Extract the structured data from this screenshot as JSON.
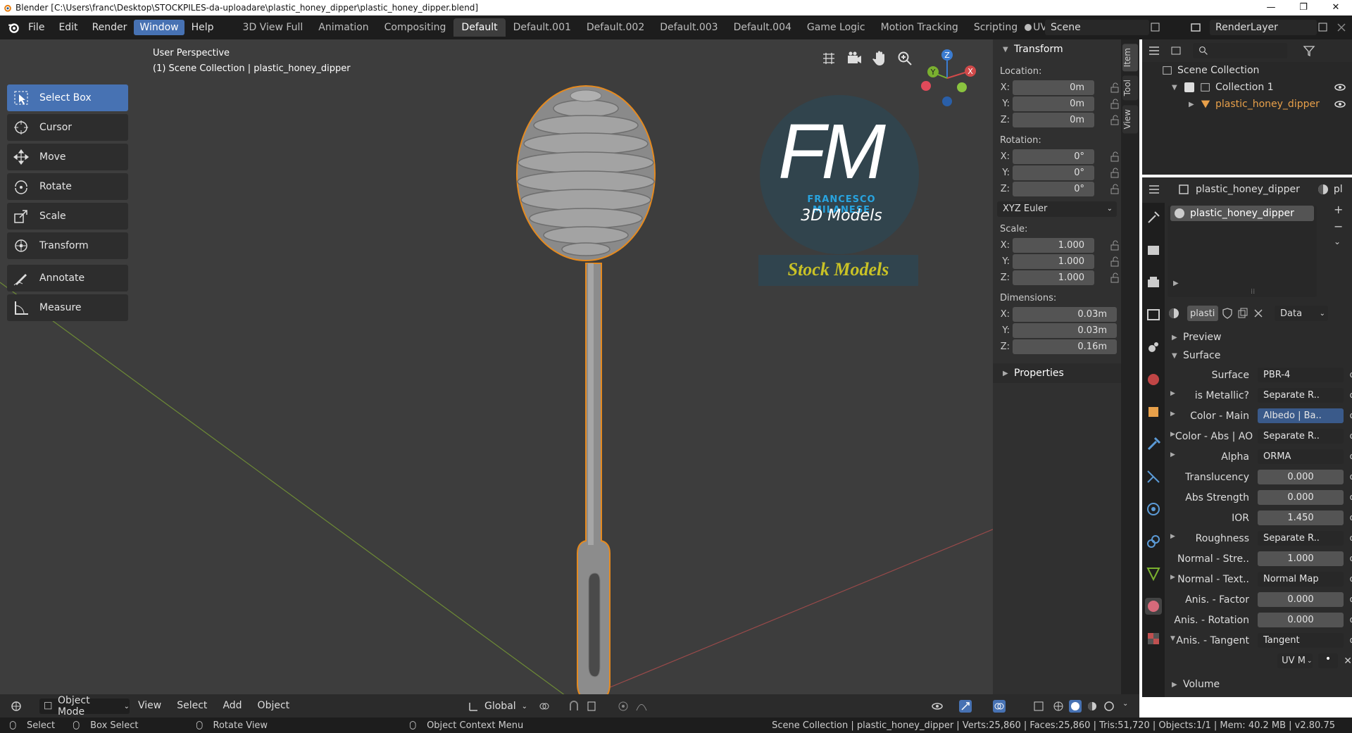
{
  "titlebar": {
    "title": "Blender [C:\\Users\\franc\\Desktop\\STOCKPILES-da-uploadare\\plastic_honey_dipper\\plastic_honey_dipper.blend]",
    "minimize": "—",
    "maximize": "❐",
    "close": "✕"
  },
  "menu": [
    "File",
    "Edit",
    "Render",
    "Window",
    "Help"
  ],
  "workspaces": [
    "3D View Full",
    "Animation",
    "Compositing",
    "Default",
    "Default.001",
    "Default.002",
    "Default.003",
    "Default.004",
    "Game Logic",
    "Motion Tracking",
    "Scripting",
    "UV Editing"
  ],
  "scene_name": "Scene",
  "renderlayer_name": "RenderLayer",
  "viewport": {
    "perspective": "User Perspective",
    "collection_info": "(1) Scene Collection | plastic_honey_dipper",
    "logo": {
      "letters": "FM",
      "name": "FRANCESCO MILANESE",
      "sub": "3D Models",
      "badge": "Stock Models"
    },
    "gizmo": {
      "x": "X",
      "y": "Y",
      "z": "Z"
    }
  },
  "tools": [
    "Select Box",
    "Cursor",
    "Move",
    "Rotate",
    "Scale",
    "Transform",
    "Annotate",
    "Measure"
  ],
  "npanel": {
    "transform_title": "Transform",
    "location_label": "Location:",
    "location": [
      {
        "axis": "X:",
        "value": "0m"
      },
      {
        "axis": "Y:",
        "value": "0m"
      },
      {
        "axis": "Z:",
        "value": "0m"
      }
    ],
    "rotation_label": "Rotation:",
    "rotation": [
      {
        "axis": "X:",
        "value": "0°"
      },
      {
        "axis": "Y:",
        "value": "0°"
      },
      {
        "axis": "Z:",
        "value": "0°"
      }
    ],
    "rotation_mode": "XYZ Euler",
    "scale_label": "Scale:",
    "scale": [
      {
        "axis": "X:",
        "value": "1.000"
      },
      {
        "axis": "Y:",
        "value": "1.000"
      },
      {
        "axis": "Z:",
        "value": "1.000"
      }
    ],
    "dimensions_label": "Dimensions:",
    "dimensions": [
      {
        "axis": "X:",
        "value": "0.03m"
      },
      {
        "axis": "Y:",
        "value": "0.03m"
      },
      {
        "axis": "Z:",
        "value": "0.16m"
      }
    ],
    "properties_title": "Properties",
    "tabs": [
      "Item",
      "Tool",
      "View"
    ]
  },
  "outliner": {
    "scene_collection": "Scene Collection",
    "collection": "Collection 1",
    "object": "plastic_honey_dipper"
  },
  "properties": {
    "object_name": "plastic_honey_dipper",
    "header_trunc": "pl",
    "material_slot": "plastic_honey_dipper",
    "material_field": "plasti",
    "data_select": "Data",
    "preview": "Preview",
    "surface_section": "Surface",
    "rows": [
      {
        "label": "Surface",
        "value": "PBR-4",
        "type": "text"
      },
      {
        "label": "is Metallic?",
        "value": "Separate R..",
        "type": "text",
        "arrow": true
      },
      {
        "label": "Color - Main",
        "value": "Albedo | Ba..",
        "type": "hl",
        "arrow": true
      },
      {
        "label": "Color - Abs | AO",
        "value": "Separate R..",
        "type": "text",
        "arrow": true
      },
      {
        "label": "Alpha",
        "value": "ORMA",
        "type": "text",
        "arrow": true
      },
      {
        "label": "Translucency",
        "value": "0.000",
        "type": "num"
      },
      {
        "label": "Abs Strength",
        "value": "0.000",
        "type": "num"
      },
      {
        "label": "IOR",
        "value": "1.450",
        "type": "num"
      },
      {
        "label": "Roughness",
        "value": "Separate R..",
        "type": "text",
        "arrow": true
      },
      {
        "label": "Normal - Stre..",
        "value": "1.000",
        "type": "num"
      },
      {
        "label": "Normal - Text..",
        "value": "Normal Map",
        "type": "text",
        "arrow": true
      },
      {
        "label": "Anis. - Factor",
        "value": "0.000",
        "type": "num"
      },
      {
        "label": "Anis. - Rotation",
        "value": "0.000",
        "type": "num"
      },
      {
        "label": "Anis. - Tangent",
        "value": "Tangent",
        "type": "text",
        "arrow": true
      }
    ],
    "uv_map": "UV M",
    "volume": "Volume"
  },
  "viewport_header": {
    "mode": "Object Mode",
    "menus": [
      "View",
      "Select",
      "Add",
      "Object"
    ],
    "orientation": "Global"
  },
  "statusbar": {
    "select": "Select",
    "box_select": "Box Select",
    "rotate_view": "Rotate View",
    "context_menu": "Object Context Menu",
    "stats": "Scene Collection | plastic_honey_dipper | Verts:25,860 | Faces:25,860 | Tris:51,720 | Objects:1/1 | Mem: 40.2 MB | v2.80.75"
  }
}
